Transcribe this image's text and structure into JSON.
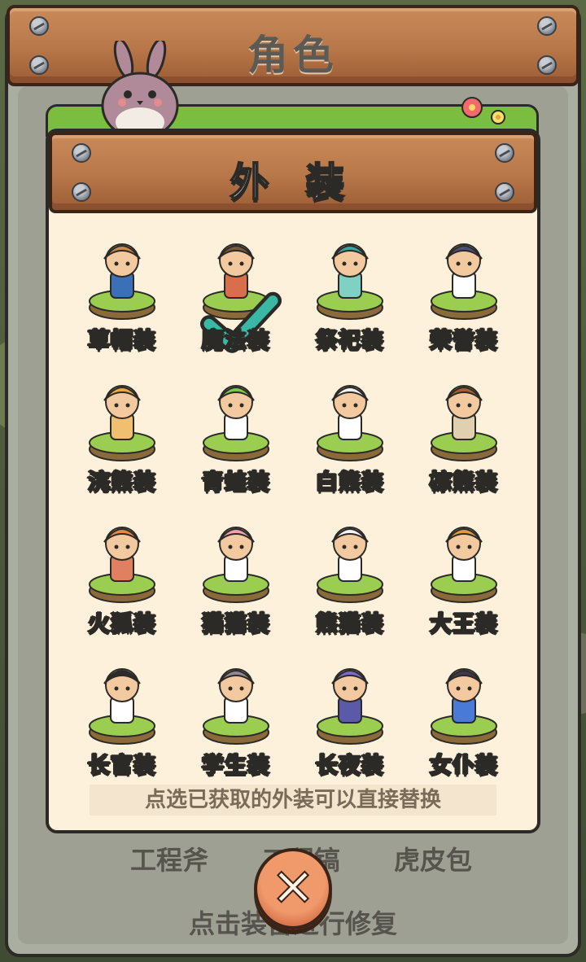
{
  "window": {
    "title": "角色"
  },
  "dialog": {
    "title": "外 装",
    "hint": "点选已获取的外装可以直接替换"
  },
  "costumes": [
    {
      "label": "草帽装",
      "hat": "#c98a4a",
      "body": "#3b6fb6",
      "selected": false
    },
    {
      "label": "魔法装",
      "hat": "#7a5a3a",
      "body": "#d86f4a",
      "selected": true
    },
    {
      "label": "祭祀装",
      "hat": "#3aa6a0",
      "body": "#7fd2c3",
      "selected": false
    },
    {
      "label": "荣誉装",
      "hat": "#4b4f78",
      "body": "#ffffff",
      "selected": false
    },
    {
      "label": "浣熊装",
      "hat": "#e8a848",
      "body": "#f0c070",
      "selected": false
    },
    {
      "label": "青蛙装",
      "hat": "#7acb4a",
      "body": "#ffffff",
      "selected": false
    },
    {
      "label": "白熊装",
      "hat": "#f2f2f2",
      "body": "#ffffff",
      "selected": false
    },
    {
      "label": "棕熊装",
      "hat": "#a55d3a",
      "body": "#e0d0b0",
      "selected": false
    },
    {
      "label": "火狐装",
      "hat": "#e8864a",
      "body": "#e08060",
      "selected": false
    },
    {
      "label": "猫猫装",
      "hat": "#f0a0b0",
      "body": "#ffffff",
      "selected": false
    },
    {
      "label": "熊猫装",
      "hat": "#f4f4f4",
      "body": "#ffffff",
      "selected": false
    },
    {
      "label": "大王装",
      "hat": "#e09a40",
      "body": "#ffffff",
      "selected": false
    },
    {
      "label": "长官装",
      "hat": "#2e2b30",
      "body": "#ffffff",
      "selected": false
    },
    {
      "label": "学生装",
      "hat": "#8b8a96",
      "body": "#ffffff",
      "selected": false
    },
    {
      "label": "长夜装",
      "hat": "#7a6ad0",
      "body": "#5a5aa8",
      "selected": false
    },
    {
      "label": "女仆装",
      "hat": "#3a3a50",
      "body": "#4a7ad8",
      "selected": false
    }
  ],
  "background": {
    "tools": [
      "工程斧",
      "工程镐",
      "虎皮包"
    ],
    "repair_text": "点击装备进行修复"
  },
  "icons": {
    "close": "close-icon",
    "check": "checkmark-icon"
  },
  "colors": {
    "wood": "#b87748",
    "panel": "#fdf1dc",
    "grass": "#7bbd3f",
    "check": "#3ab8a6"
  }
}
